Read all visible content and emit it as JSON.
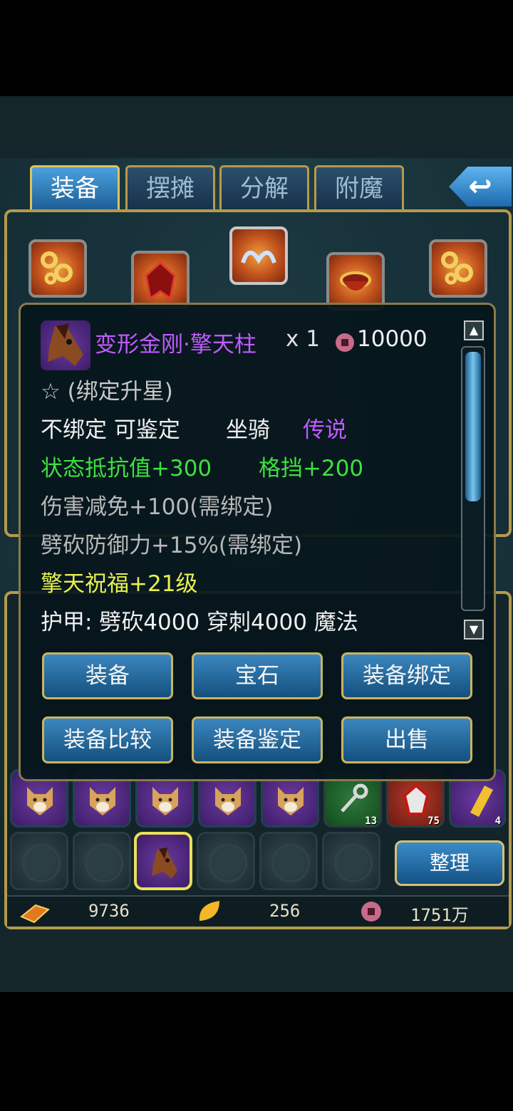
{
  "tabs": [
    {
      "label": "装备",
      "active": true
    },
    {
      "label": "摆摊",
      "active": false
    },
    {
      "label": "分解",
      "active": false
    },
    {
      "label": "附魔",
      "active": false
    }
  ],
  "back_button": {
    "icon": "back-arrow-icon"
  },
  "item": {
    "name": "变形金刚·擎天柱",
    "quantity": "x 1",
    "price": "10000",
    "price_icon": "coin-icon",
    "star_line": "☆ (绑定升星)",
    "line_bind": "不绑定 可鉴定",
    "line_type": "坐骑",
    "line_quality": "传说",
    "stat_resist": "状态抵抗值+300",
    "stat_block": "格挡+200",
    "stat_dmg_reduce": "伤害减免+100(需绑定)",
    "stat_slash_def": "劈砍防御力+15%(需绑定)",
    "stat_blessing": "擎天祝福+21级",
    "armor_line": "护甲: 劈砍4000  穿刺4000  魔法"
  },
  "actions": [
    "装备",
    "宝石",
    "装备绑定",
    "装备比较",
    "装备鉴定",
    "出售"
  ],
  "inventory": {
    "counts": [
      "13",
      "75",
      "4"
    ],
    "sort_label": "整理"
  },
  "currency": {
    "gold": "9736",
    "leaf": "256",
    "coins": "1751万"
  },
  "colors": {
    "item_name": "#c15bff",
    "quality": "#c15bff",
    "green_stat": "#3ee03e",
    "grey_stat": "#b8b8b8",
    "yellow_stat": "#e8f050",
    "white_text": "#f0f0f0",
    "frame_gold": "#b59a4c"
  }
}
